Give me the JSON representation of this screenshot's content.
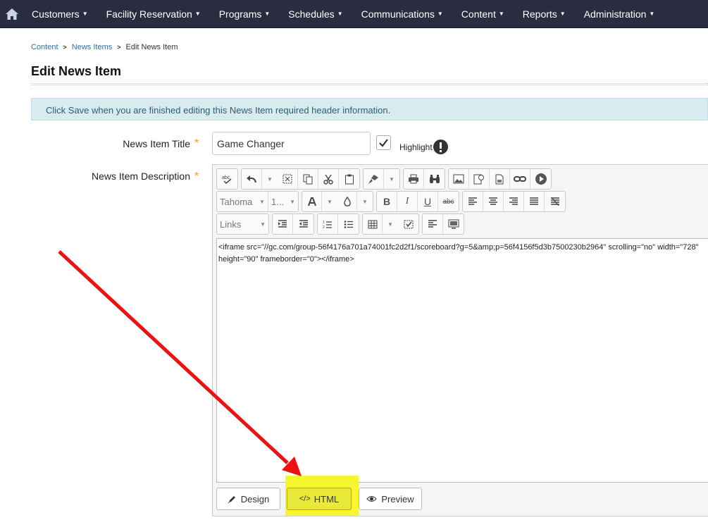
{
  "nav": {
    "home_icon": "home-icon",
    "items": [
      {
        "label": "Customers"
      },
      {
        "label": "Facility Reservation"
      },
      {
        "label": "Programs"
      },
      {
        "label": "Schedules"
      },
      {
        "label": "Communications"
      },
      {
        "label": "Content"
      },
      {
        "label": "Reports"
      },
      {
        "label": "Administration"
      }
    ]
  },
  "breadcrumb": {
    "items": [
      {
        "label": "Content"
      },
      {
        "label": "News Items"
      }
    ],
    "current": "Edit News Item"
  },
  "page": {
    "title": "Edit News Item",
    "info": "Click Save when you are finished editing this News Item required header information."
  },
  "form": {
    "title_label": "News Item Title",
    "title_value": "Game Changer",
    "highlight_label": "Highlight",
    "highlight_checked": true,
    "description_label": "News Item Description",
    "required_mark": "*"
  },
  "editor": {
    "font_name": "Tahoma",
    "font_size": "1...",
    "links": "Links",
    "content": "<iframe src=\"//gc.com/group-56f4176a701a74001fc2d2f1/scoreboard?g=5&amp;p=56f4156f5d3b7500230b2964\" scrolling=\"no\" width=\"728\" height=\"90\" frameborder=\"0\"></iframe>",
    "modes": {
      "design": "Design",
      "html": "HTML",
      "preview": "Preview"
    }
  },
  "colors": {
    "nav_bg": "#2a2c3f",
    "info_bg": "#d8ecf0",
    "link": "#2f6fa7",
    "required": "#f0a020",
    "highlight_yellow": "#f6f62f",
    "arrow_red": "#ee1111"
  }
}
